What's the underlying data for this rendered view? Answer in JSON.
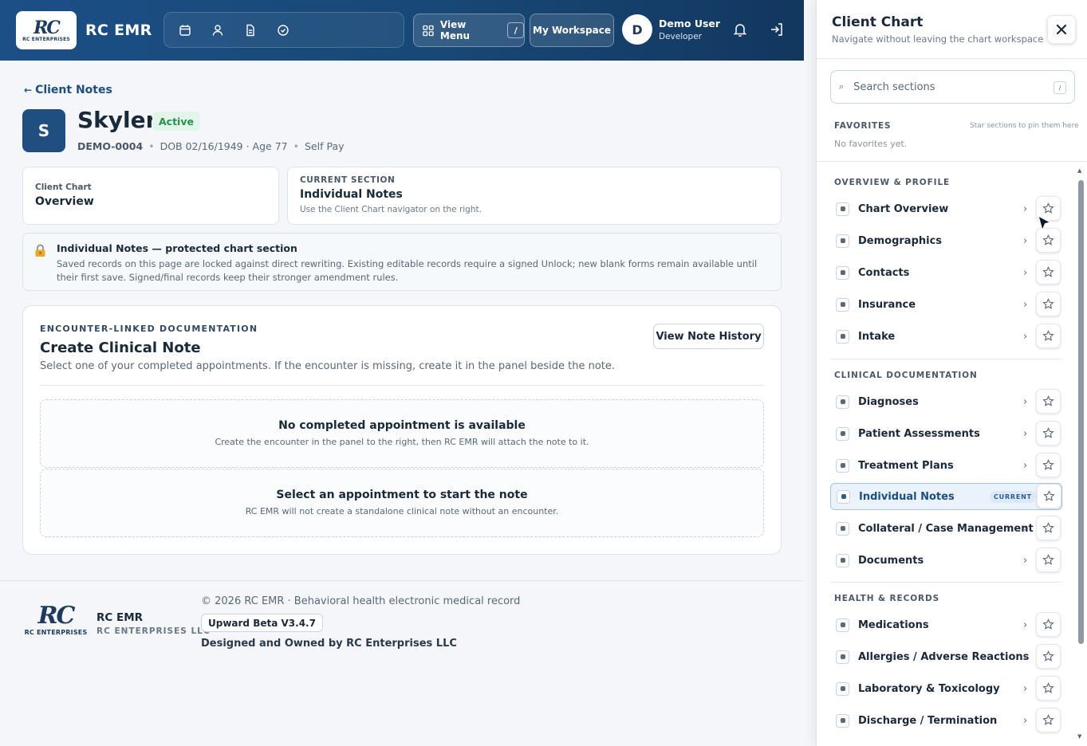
{
  "header": {
    "logo_mark": "RC",
    "logo_sub": "RC ENTERPRISES",
    "brand": "RC EMR",
    "icons": [
      "calendar-icon",
      "person-icon",
      "document-icon",
      "check-circle-icon"
    ],
    "view_menu_label": "View Menu",
    "view_menu_shortcut": "/",
    "workspace_label": "My Workspace",
    "user": {
      "initial": "D",
      "name": "Demo User",
      "role": "Developer"
    }
  },
  "client": {
    "back_arrow": "←",
    "back_label": "Client Notes",
    "initial": "S",
    "name": "Skyler",
    "status": "Active",
    "id": "DEMO-0004",
    "dob_age": "DOB 02/16/1949 · Age 77",
    "payer": "Self Pay",
    "separator": "•"
  },
  "cards": {
    "chart_label": "Client Chart",
    "chart_value": "Overview",
    "section_label": "CURRENT SECTION",
    "section_value": "Individual Notes",
    "section_hint": "Use the Client Chart navigator on the right."
  },
  "notice": {
    "title": "Individual Notes — protected chart section",
    "body": "Saved records on this page are locked against direct rewriting. Existing editable records require a signed Unlock; new blank forms remain available until their first save. Signed/final records keep their stronger amendment rules."
  },
  "note": {
    "eyebrow": "ENCOUNTER-LINKED DOCUMENTATION",
    "title": "Create Clinical Note",
    "description": "Select one of your completed appointments. If the encounter is missing, create it in the panel beside the note.",
    "history_button": "View Note History",
    "empty1_title": "No completed appointment is available",
    "empty1_sub": "Create the encounter in the panel to the right, then RC EMR will attach the note to it.",
    "empty2_title": "Select an appointment to start the note",
    "empty2_sub": "RC EMR will not create a standalone clinical note without an encounter."
  },
  "footer": {
    "logo_mark": "RC",
    "logo_sub": "RC ENTERPRISES",
    "brand": "RC EMR",
    "company": "RC ENTERPRISES LLC",
    "copyright": "© 2026 RC EMR · Behavioral health electronic medical record",
    "version": "Upward Beta V3.4.7",
    "owned": "Designed and Owned by RC Enterprises LLC"
  },
  "panel": {
    "title": "Client Chart",
    "subtitle": "Navigate without leaving the chart workspace",
    "search_placeholder": "Search sections",
    "search_icon": "⌕",
    "search_shortcut": "/",
    "favorites_label": "FAVORITES",
    "favorites_hint": "Star sections to pin them here",
    "favorites_empty": "No favorites yet.",
    "current_tag": "CURRENT",
    "chevron": "›",
    "groups": [
      {
        "label": "OVERVIEW & PROFILE",
        "items": [
          "Chart Overview",
          "Demographics",
          "Contacts",
          "Insurance",
          "Intake"
        ]
      },
      {
        "label": "CLINICAL DOCUMENTATION",
        "items": [
          "Diagnoses",
          "Patient Assessments",
          "Treatment Plans",
          "Individual Notes",
          "Collateral / Case Management",
          "Documents"
        ]
      },
      {
        "label": "HEALTH & RECORDS",
        "items": [
          "Medications",
          "Allergies / Adverse Reactions",
          "Laboratory & Toxicology",
          "Discharge / Termination"
        ]
      }
    ]
  },
  "colors": {
    "brand_navy": "#1b4f86",
    "status_green": "#23924b",
    "current_highlight": "#eaf2fb"
  }
}
